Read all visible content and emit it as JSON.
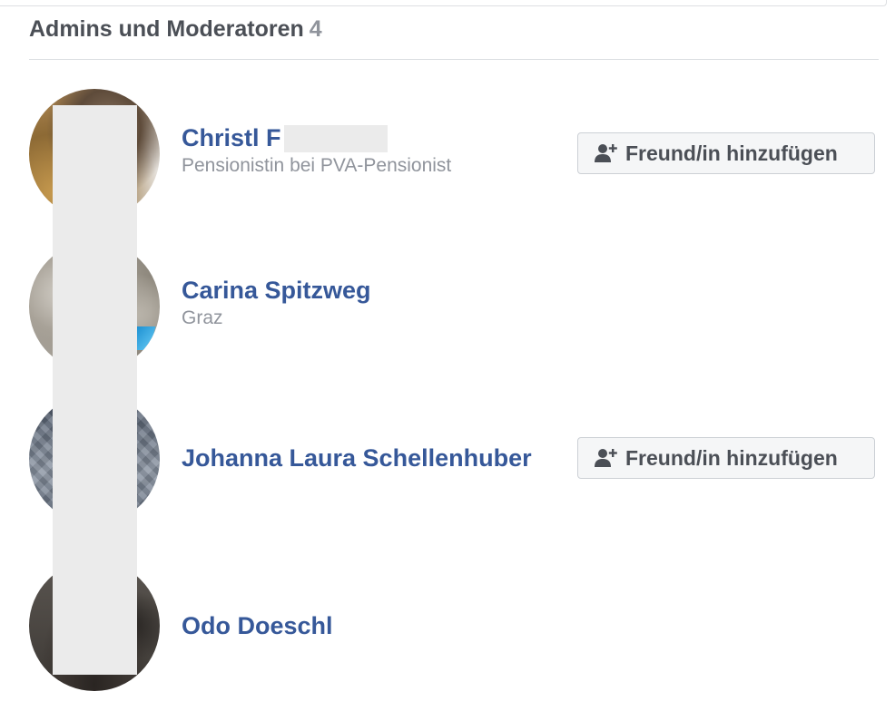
{
  "section": {
    "title": "Admins und Moderatoren",
    "count": "4"
  },
  "members": [
    {
      "name": "Christl F",
      "subtitle": "Pensionistin bei PVA-Pensionist",
      "action_label": "Freund/in hinzufügen"
    },
    {
      "name": "Carina Spitzweg",
      "subtitle": "Graz"
    },
    {
      "name": "Johanna Laura Schellenhuber",
      "subtitle": "",
      "action_label": "Freund/in hinzufügen"
    },
    {
      "name": "Odo Doeschl",
      "subtitle": ""
    }
  ],
  "colors": {
    "name_link": "#365899",
    "subtitle": "#90949c",
    "header_text": "#4b4f56",
    "button_bg": "#f5f6f7",
    "button_border": "#ccd0d5"
  },
  "icons": {
    "add_friend": "user-plus-icon"
  }
}
